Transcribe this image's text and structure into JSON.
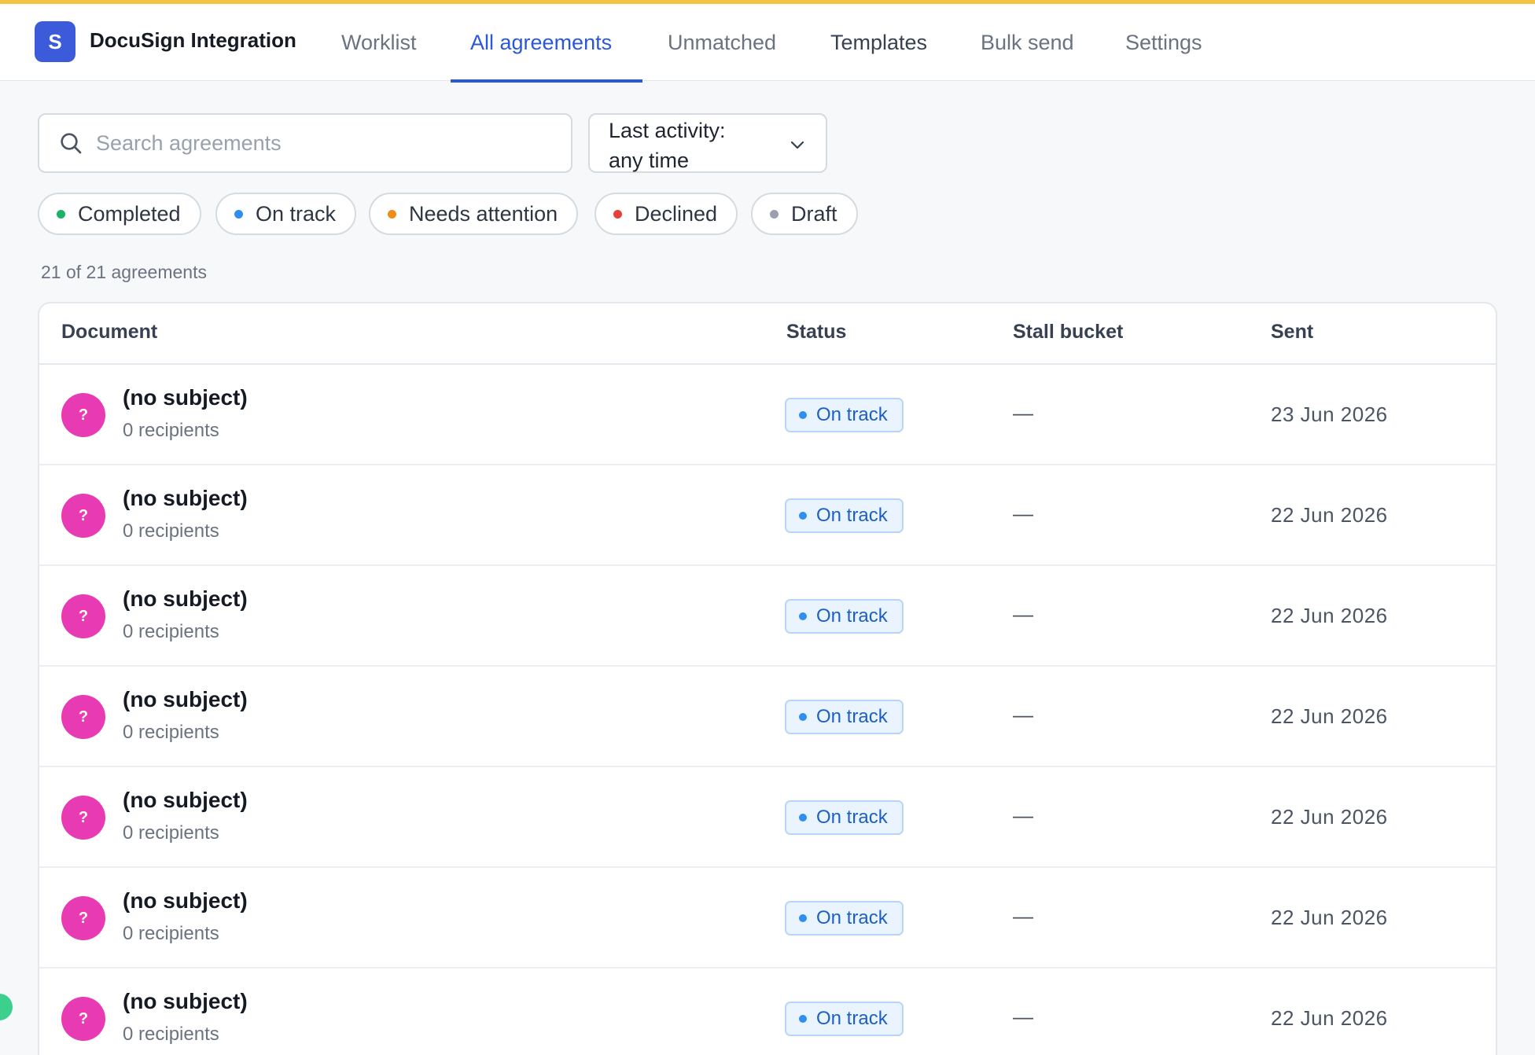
{
  "app": {
    "logo_letter": "S",
    "title": "DocuSign Integration"
  },
  "nav": {
    "tabs": [
      {
        "label": "Worklist"
      },
      {
        "label": "All agreements",
        "active": true
      },
      {
        "label": "Unmatched"
      },
      {
        "label": "Templates"
      },
      {
        "label": "Bulk send"
      },
      {
        "label": "Settings"
      }
    ]
  },
  "search": {
    "placeholder": "Search agreements",
    "value": ""
  },
  "activity_filter": {
    "line1": "Last activity:",
    "line2": "any time"
  },
  "status_chips": [
    {
      "label": "Completed",
      "color": "#1bb36a"
    },
    {
      "label": "On track",
      "color": "#2f8ef0"
    },
    {
      "label": "Needs attention",
      "color": "#f08c1a"
    },
    {
      "label": "Declined",
      "color": "#e5413a"
    },
    {
      "label": "Draft",
      "color": "#9aa1ad"
    }
  ],
  "count_text": "21 of 21 agreements",
  "table": {
    "columns": [
      "Document",
      "Status",
      "Stall bucket",
      "Sent"
    ],
    "rows": [
      {
        "avatar": "?",
        "title": "(no subject)",
        "subtitle": "0 recipients",
        "status": "On track",
        "stall": "—",
        "sent": "23 Jun 2026"
      },
      {
        "avatar": "?",
        "title": "(no subject)",
        "subtitle": "0 recipients",
        "status": "On track",
        "stall": "—",
        "sent": "22 Jun 2026"
      },
      {
        "avatar": "?",
        "title": "(no subject)",
        "subtitle": "0 recipients",
        "status": "On track",
        "stall": "—",
        "sent": "22 Jun 2026"
      },
      {
        "avatar": "?",
        "title": "(no subject)",
        "subtitle": "0 recipients",
        "status": "On track",
        "stall": "—",
        "sent": "22 Jun 2026"
      },
      {
        "avatar": "?",
        "title": "(no subject)",
        "subtitle": "0 recipients",
        "status": "On track",
        "stall": "—",
        "sent": "22 Jun 2026"
      },
      {
        "avatar": "?",
        "title": "(no subject)",
        "subtitle": "0 recipients",
        "status": "On track",
        "stall": "—",
        "sent": "22 Jun 2026"
      },
      {
        "avatar": "?",
        "title": "(no subject)",
        "subtitle": "0 recipients",
        "status": "On track",
        "stall": "—",
        "sent": "22 Jun 2026"
      }
    ]
  },
  "colors": {
    "accent": "#2b58d6",
    "brand_bar": "#f5c342",
    "avatar": "#e83bb3",
    "help_bubble": "#3ccf8e"
  }
}
